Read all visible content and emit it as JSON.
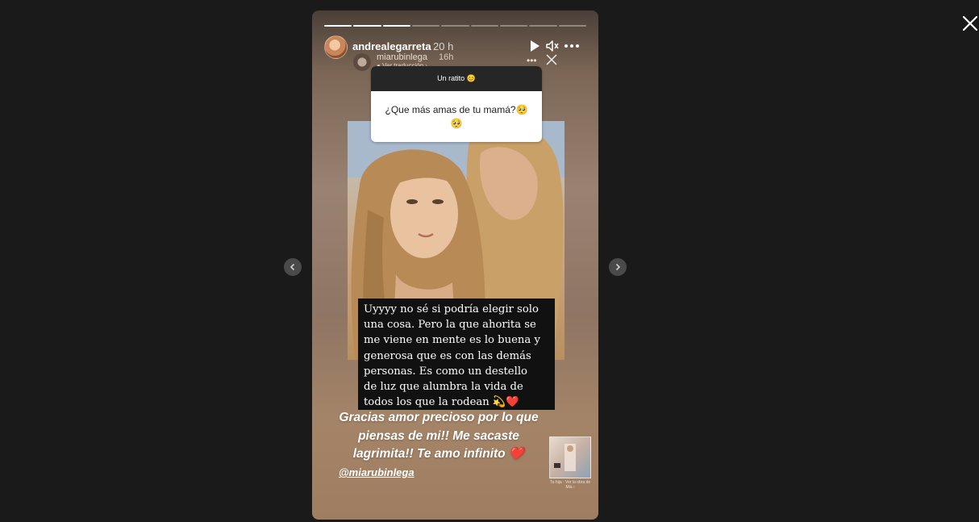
{
  "viewer": {
    "close_icon": "close-icon",
    "prev_icon": "chevron-left-icon",
    "next_icon": "chevron-right-icon"
  },
  "story": {
    "progress_total": 9,
    "progress_done": 3,
    "author": "andrealegarreta",
    "time": "20 h",
    "controls": [
      "play-icon",
      "mute-icon",
      "more-icon"
    ],
    "reshared": {
      "user": "miarubinlega",
      "time": "16h",
      "translate": "● Ver traducción ›"
    },
    "question": {
      "header": "Un ratito 😊",
      "text_line1": "¿Que más amas de tu mamá?🥺",
      "text_line2": "🥺"
    },
    "answer_lines": [
      "Uyyyy no sé si podría elegir solo",
      "una cosa. Pero la que ahorita se",
      "me viene en mente es lo buena y",
      "generosa que es con las demás",
      "personas. Es como un destello",
      "de luz que alumbra la vida de",
      "todos los que la rodean 💫❤️"
    ],
    "caption_lines": [
      "Gracias amor precioso por lo que",
      "piensas de mi!! Me sacaste",
      "lagrimita!! Te amo infinito ❤️"
    ],
    "mention": "@miarubinlega",
    "thumbnail_label": "Tu hija · Ver la obra de Mia ›"
  }
}
